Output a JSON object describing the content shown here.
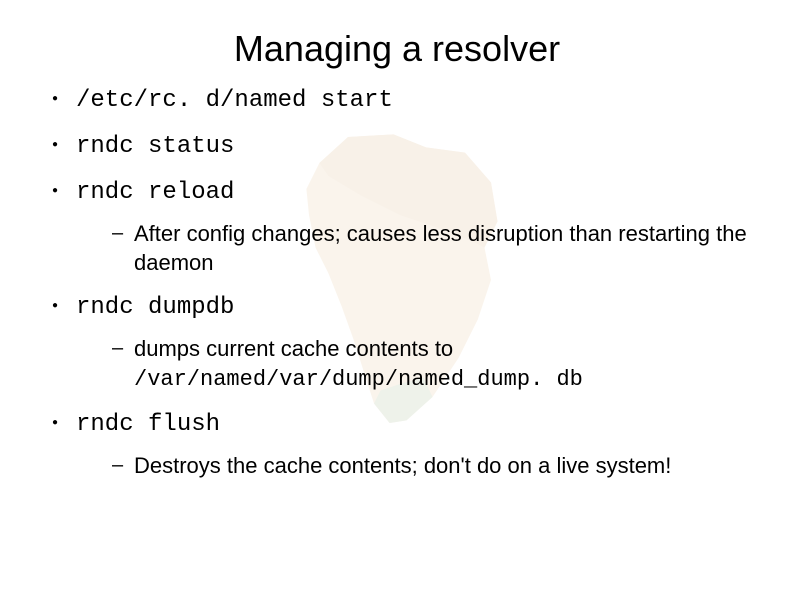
{
  "title": "Managing a resolver",
  "bullets": {
    "b0": {
      "cmd": "/etc/rc. d/named start"
    },
    "b1": {
      "cmd": "rndc status"
    },
    "b2": {
      "cmd": "rndc reload",
      "sub": "After config changes; causes less disruption than restarting the daemon"
    },
    "b3": {
      "cmd": "rndc dumpdb",
      "sub_prefix": "dumps current cache contents to ",
      "sub_code": "/var/named/var/dump/named_dump. db"
    },
    "b4": {
      "cmd": "rndc flush",
      "sub": "Destroys the cache contents; don't do on a live system!"
    }
  }
}
